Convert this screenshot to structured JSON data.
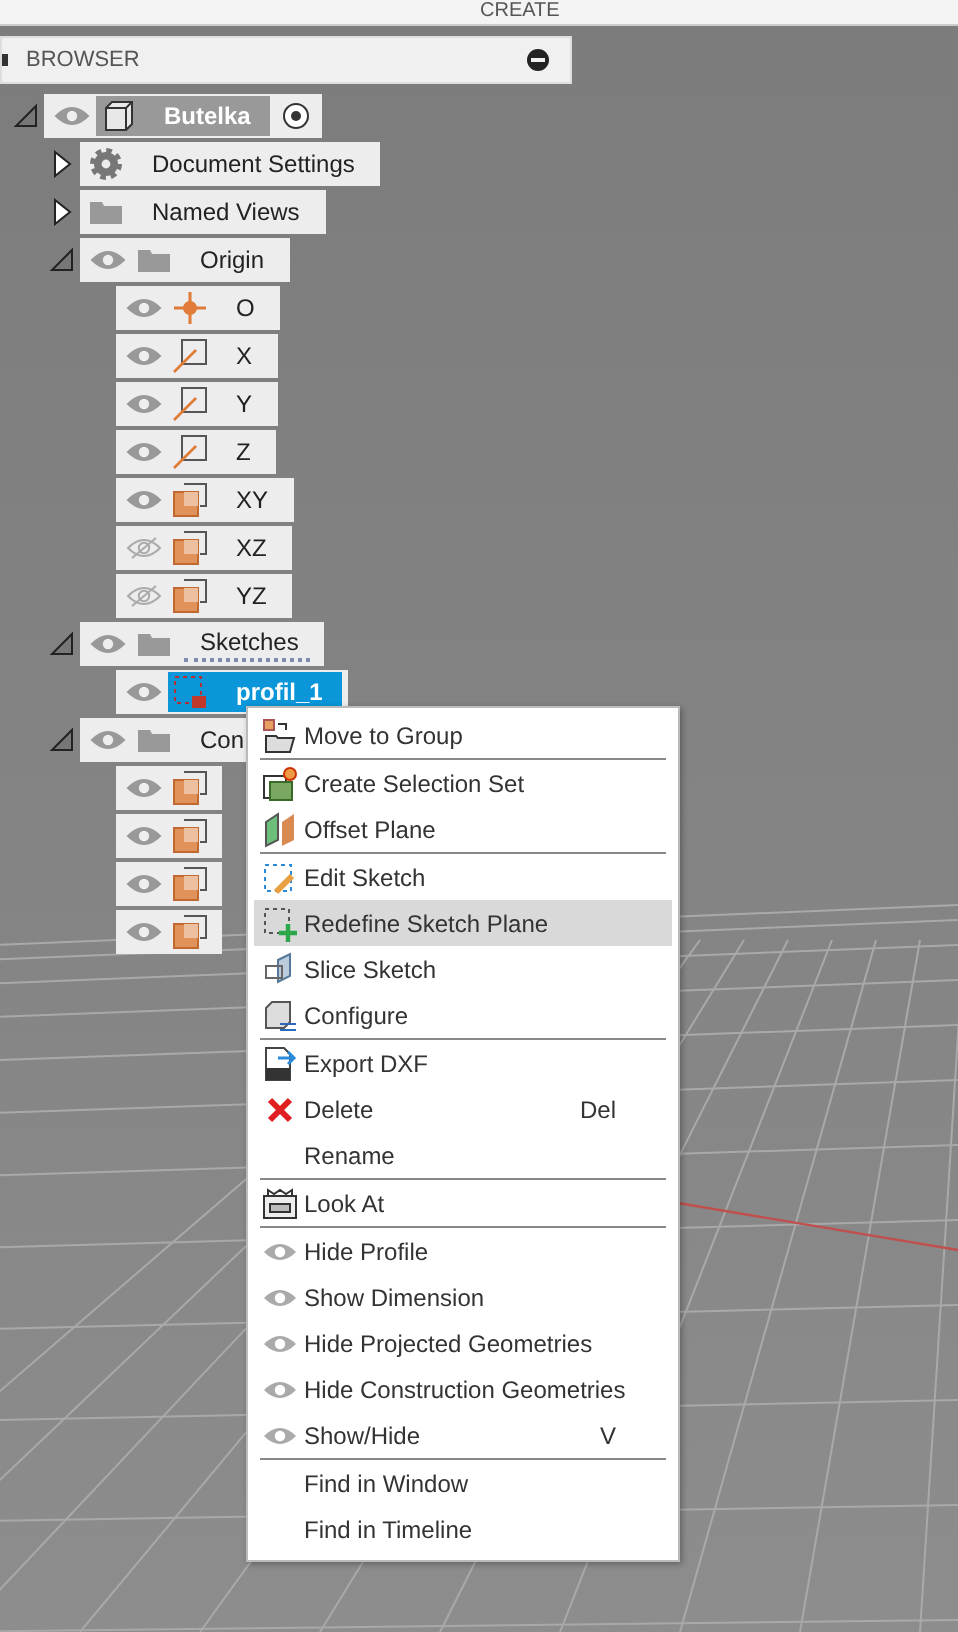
{
  "toolbar": {
    "label": "CREATE"
  },
  "browser": {
    "title": "BROWSER",
    "tree": [
      {
        "label": "Butelka",
        "kind": "component",
        "expanded": true,
        "visible": true,
        "active": true,
        "selected": false,
        "children": [
          {
            "label": "Document Settings",
            "kind": "gear",
            "expanded": false,
            "selected": false
          },
          {
            "label": "Named Views",
            "kind": "folder",
            "expanded": false,
            "selected": false
          },
          {
            "label": "Origin",
            "kind": "folder",
            "expanded": true,
            "visible": true,
            "selected": false,
            "children": [
              {
                "label": "O",
                "kind": "point",
                "visible": true,
                "selected": false
              },
              {
                "label": "X",
                "kind": "axis",
                "visible": true,
                "selected": false
              },
              {
                "label": "Y",
                "kind": "axis",
                "visible": true,
                "selected": false
              },
              {
                "label": "Z",
                "kind": "axis",
                "visible": true,
                "selected": false
              },
              {
                "label": "XY",
                "kind": "plane",
                "visible": true,
                "selected": false
              },
              {
                "label": "XZ",
                "kind": "plane",
                "visible": false,
                "selected": false
              },
              {
                "label": "YZ",
                "kind": "plane",
                "visible": false,
                "selected": false
              }
            ]
          },
          {
            "label": "Sketches",
            "kind": "sketch-folder",
            "expanded": true,
            "visible": true,
            "selected": false,
            "children": [
              {
                "label": "profil_1",
                "kind": "sketch",
                "visible": true,
                "selected": true
              }
            ]
          },
          {
            "label": "Con",
            "kind": "folder",
            "expanded": true,
            "visible": true,
            "selected": false,
            "children": [
              {
                "kind": "plane",
                "visible": true,
                "selected": false
              },
              {
                "kind": "plane",
                "visible": true,
                "selected": false
              },
              {
                "kind": "plane",
                "visible": true,
                "selected": false
              },
              {
                "kind": "plane",
                "visible": true,
                "selected": false
              }
            ]
          }
        ]
      }
    ]
  },
  "context_menu": {
    "groups": [
      [
        {
          "label": "Move to Group",
          "kind": "move"
        }
      ],
      [
        {
          "label": "Create Selection Set",
          "kind": "selection-set"
        },
        {
          "label": "Offset Plane",
          "kind": "offset-plane"
        }
      ],
      [
        {
          "label": "Edit Sketch",
          "kind": "edit-sketch",
          "selected": false
        },
        {
          "label": "Redefine Sketch Plane",
          "kind": "redefine",
          "selected": true
        },
        {
          "label": "Slice Sketch",
          "kind": "slice",
          "selected": false
        },
        {
          "label": "Configure",
          "kind": "configure",
          "selected": false
        }
      ],
      [
        {
          "label": "Export DXF",
          "kind": "dxf"
        },
        {
          "label": "Delete",
          "kind": "delete",
          "shortcut": "Del"
        },
        {
          "label": "Rename",
          "kind": "plain"
        }
      ],
      [
        {
          "label": "Look At",
          "kind": "look"
        }
      ],
      [
        {
          "label": "Hide Profile",
          "kind": "eye"
        },
        {
          "label": "Show Dimension",
          "kind": "eye"
        },
        {
          "label": "Hide Projected Geometries",
          "kind": "eye"
        },
        {
          "label": "Hide Construction Geometries",
          "kind": "eye"
        },
        {
          "label": "Show/Hide",
          "kind": "eye",
          "shortcut": "V"
        }
      ],
      [
        {
          "label": "Find in Window",
          "kind": "plain"
        },
        {
          "label": "Find in Timeline",
          "kind": "plain"
        }
      ]
    ]
  }
}
